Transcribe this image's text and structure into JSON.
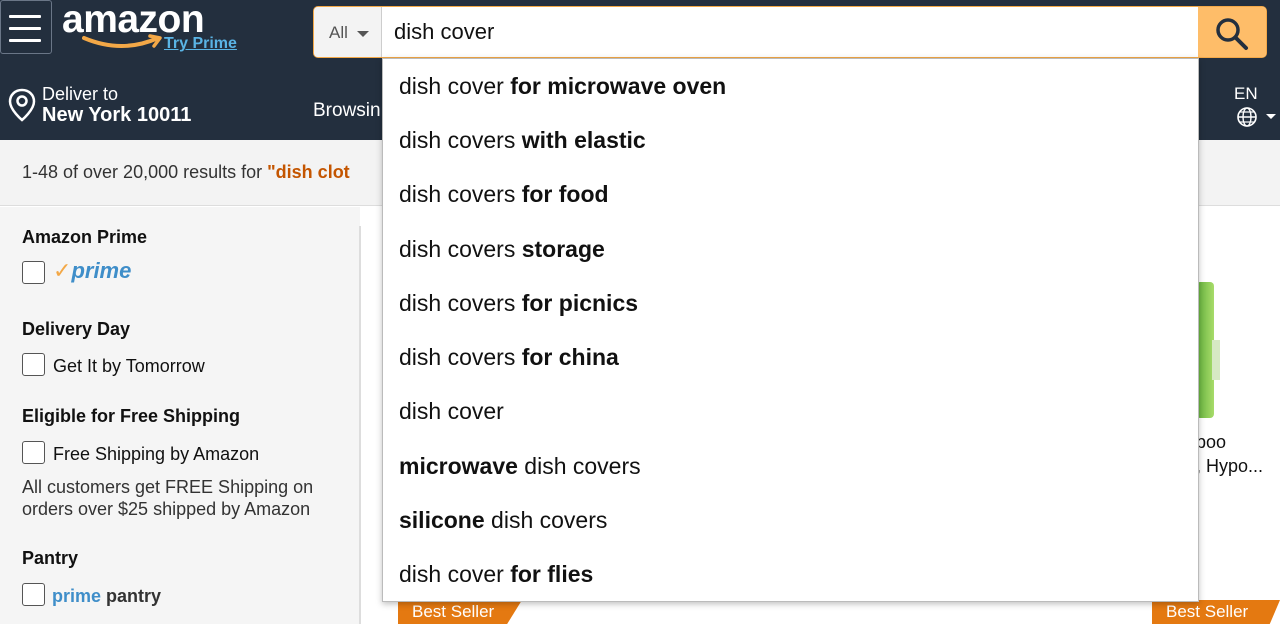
{
  "header": {
    "logo_text": "amazon",
    "logo_sub": "Try Prime",
    "search_category": "All",
    "search_value": "dish cover",
    "deliver_line1": "Deliver to",
    "deliver_line2": "New York 10011",
    "browsing_text": "Browsin",
    "language": "EN"
  },
  "results": {
    "prefix": "1-48 of over 20,000 results for ",
    "query": "\"dish clot"
  },
  "sidebar": {
    "amazon_prime_heading": "Amazon Prime",
    "prime_check": "✓",
    "prime_word": "prime",
    "delivery_heading": "Delivery Day",
    "delivery_option": "Get It by Tomorrow",
    "shipping_heading": "Eligible for Free Shipping",
    "shipping_option": "Free Shipping by Amazon",
    "shipping_note": "All customers get FREE Shipping on orders over $25 shipped by Amazon",
    "pantry_heading": "Pantry",
    "pantry_prime": "prime",
    "pantry_word": "pantry"
  },
  "main": {
    "snippet_line1": "boo",
    "snippet_line2": ", Hypo...",
    "badge_left": "Best Seller",
    "badge_right": "Best Seller"
  },
  "suggestions": [
    {
      "plain": "dish cover",
      "bold": " for microwave oven",
      "bold_first": false
    },
    {
      "plain": "dish covers",
      "bold": " with elastic",
      "bold_first": false
    },
    {
      "plain": "dish covers",
      "bold": " for food",
      "bold_first": false
    },
    {
      "plain": "dish covers",
      "bold": " storage",
      "bold_first": false
    },
    {
      "plain": "dish covers",
      "bold": " for picnics",
      "bold_first": false
    },
    {
      "plain": "dish covers",
      "bold": " for china",
      "bold_first": false
    },
    {
      "plain": "dish cover",
      "bold": "",
      "bold_first": false
    },
    {
      "plain": " dish covers",
      "bold": "microwave",
      "bold_first": true
    },
    {
      "plain": " dish covers",
      "bold": "silicone",
      "bold_first": true
    },
    {
      "plain": "dish cover",
      "bold": " for flies",
      "bold_first": false
    }
  ],
  "colors": {
    "nav_bg": "#232f3e",
    "search_button": "#febd69",
    "search_border": "#f3a847",
    "query_highlight": "#c45500",
    "prime_blue": "#3f8ec9",
    "best_seller": "#e47911"
  }
}
